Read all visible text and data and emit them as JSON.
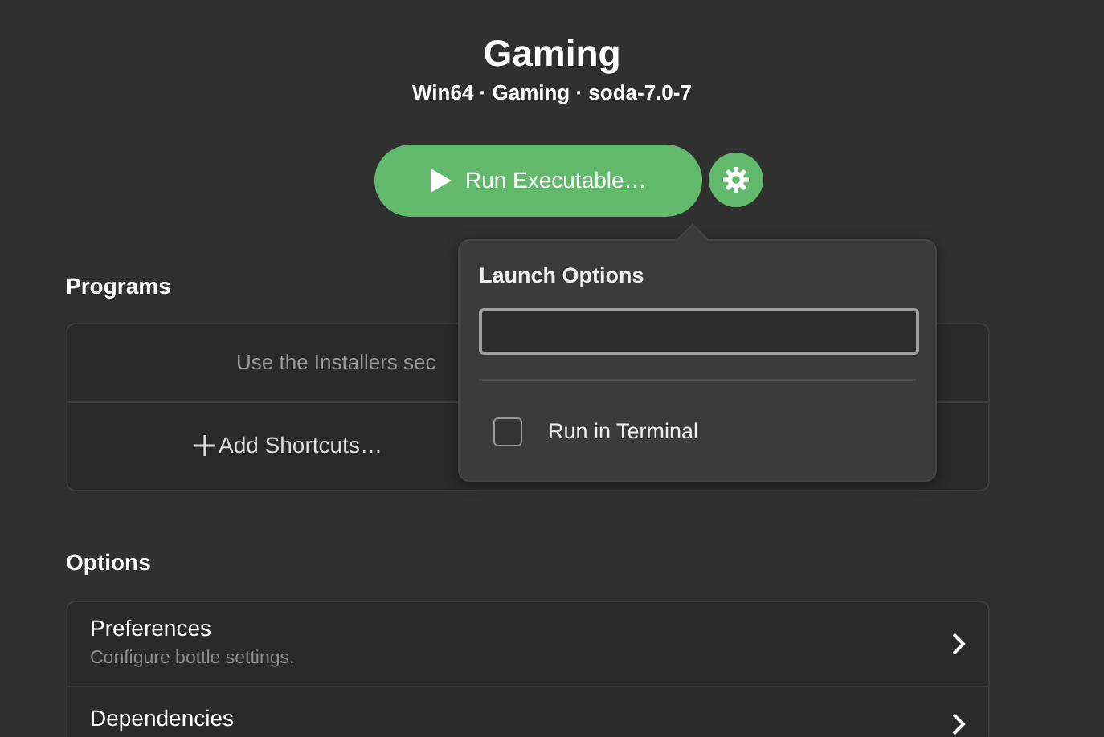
{
  "header": {
    "title": "Gaming",
    "subtitle": "Win64 · Gaming · soda-7.0-7"
  },
  "run_button": {
    "label": "Run Executable…"
  },
  "programs": {
    "heading": "Programs",
    "hint": "Use the Installers sec",
    "add_button": "Add Shortcuts…"
  },
  "options": {
    "heading": "Options",
    "rows": [
      {
        "title": "Preferences",
        "subtitle": "Configure bottle settings."
      },
      {
        "title": "Dependencies"
      }
    ]
  },
  "launch_popover": {
    "title": "Launch Options",
    "checkbox": {
      "label": "Run in Terminal",
      "checked": false
    }
  }
}
